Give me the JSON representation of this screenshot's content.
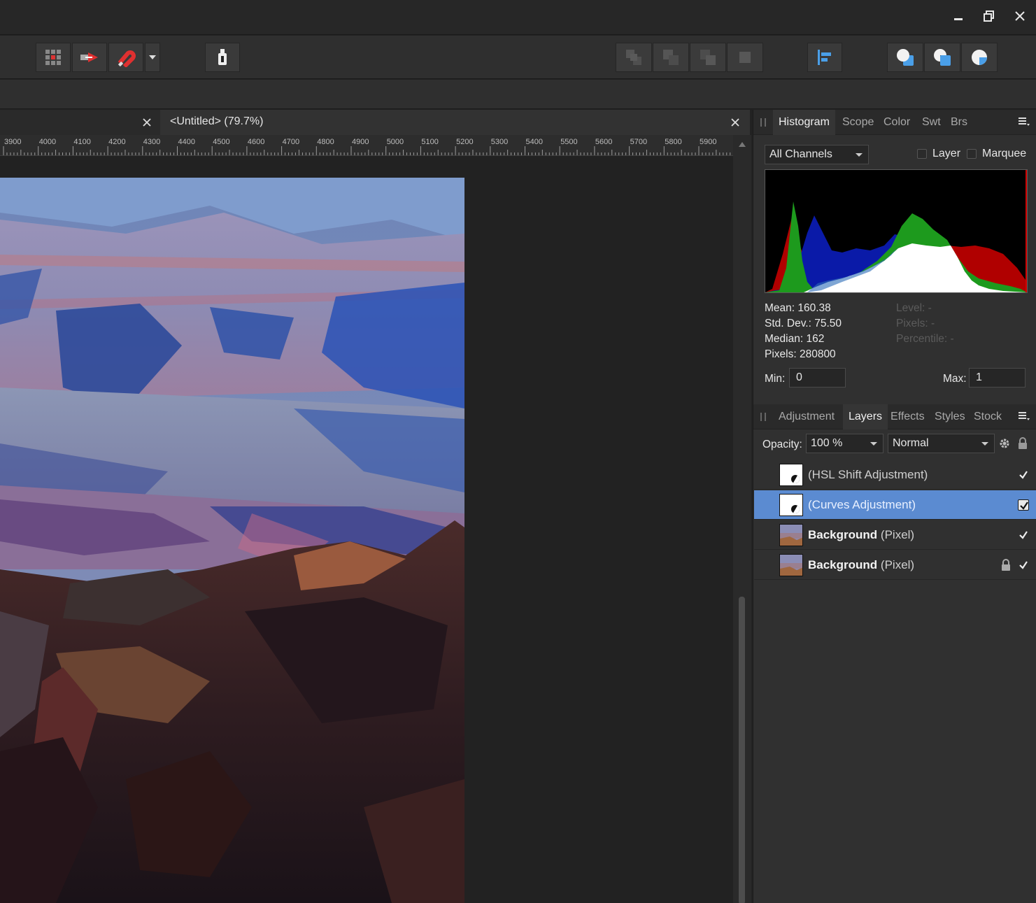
{
  "window": {
    "minimize_icon": "minimize-icon",
    "restore_icon": "restore-icon",
    "close_icon": "close-icon"
  },
  "toolbar": {
    "buttons": [
      "grid-icon",
      "move-arrow-icon",
      "snapping-magnet-icon",
      "dropdown-arrow-icon",
      "mask-icon",
      "arrange-back-icon",
      "arrange-backward-icon",
      "arrange-forward-icon",
      "arrange-front-icon",
      "align-left-icon",
      "boolean-add-icon",
      "boolean-subtract-icon",
      "boolean-intersect-icon"
    ]
  },
  "documents": {
    "tabs": [
      {
        "label": ""
      },
      {
        "label": "<Untitled> (79.7%)"
      }
    ]
  },
  "ruler": {
    "labels": [
      "3900",
      "4000",
      "4100",
      "4200",
      "4300",
      "4400",
      "4500",
      "4600",
      "4700",
      "4800",
      "4900",
      "5000",
      "5100",
      "5200",
      "5300",
      "5400",
      "5500",
      "5600",
      "5700",
      "5800",
      "5900"
    ]
  },
  "histogram_panel": {
    "tabs": [
      "Histogram",
      "Scope",
      "Color",
      "Swt",
      "Brs"
    ],
    "active_tab": "Histogram",
    "channel": "All Channels",
    "options": [
      {
        "label": "Layer",
        "checked": false
      },
      {
        "label": "Marquee",
        "checked": false
      }
    ],
    "stats_left": [
      "Mean: 160.38",
      "Std. Dev.: 75.50",
      "Median: 162",
      "Pixels: 280800"
    ],
    "stats_right": [
      "Level: -",
      "Pixels: -",
      "Percentile: -"
    ],
    "min_label": "Min:",
    "min_value": "0",
    "max_label": "Max:",
    "max_value": "1"
  },
  "layers_panel": {
    "tabs": [
      "Adjustment",
      "Layers",
      "Effects",
      "Styles",
      "Stock"
    ],
    "active_tab": "Layers",
    "opacity_label": "Opacity:",
    "opacity_value": "100 %",
    "blend_mode": "Normal",
    "layers": [
      {
        "bold": "",
        "name": "(HSL Shift Adjustment)",
        "type": "adjustment",
        "visible": true,
        "locked": false,
        "selected": false
      },
      {
        "bold": "",
        "name": "(Curves Adjustment)",
        "type": "adjustment",
        "visible": true,
        "locked": false,
        "selected": true
      },
      {
        "bold": "Background",
        "name": " (Pixel)",
        "type": "pixel",
        "visible": true,
        "locked": false,
        "selected": false
      },
      {
        "bold": "Background",
        "name": " (Pixel)",
        "type": "pixel",
        "visible": true,
        "locked": true,
        "selected": false
      }
    ]
  },
  "colors": {
    "selection": "#5b8bd1",
    "accent_blue": "#4a9fe8",
    "histogram_red": "#b00000",
    "histogram_green": "#1d9a1d",
    "histogram_blue": "#0a1aa8"
  }
}
